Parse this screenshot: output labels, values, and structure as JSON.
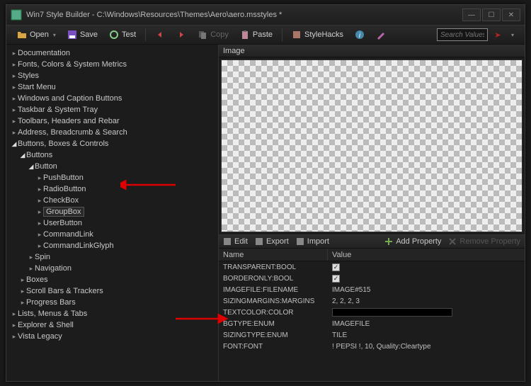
{
  "window": {
    "title": "Win7 Style Builder - C:\\Windows\\Resources\\Themes\\Aero\\aero.msstyles *"
  },
  "toolbar": {
    "open": "Open",
    "save": "Save",
    "test": "Test",
    "copy": "Copy",
    "paste": "Paste",
    "stylehacks": "StyleHacks",
    "search_placeholder": "Search Values"
  },
  "tree": {
    "items": [
      {
        "label": "Documentation",
        "indent": 0,
        "open": false
      },
      {
        "label": "Fonts, Colors & System Metrics",
        "indent": 0,
        "open": false
      },
      {
        "label": "Styles",
        "indent": 0,
        "open": false
      },
      {
        "label": "Start Menu",
        "indent": 0,
        "open": false
      },
      {
        "label": "Windows and Caption Buttons",
        "indent": 0,
        "open": false
      },
      {
        "label": "Taskbar & System Tray",
        "indent": 0,
        "open": false
      },
      {
        "label": "Toolbars, Headers and Rebar",
        "indent": 0,
        "open": false
      },
      {
        "label": "Address, Breadcrumb & Search",
        "indent": 0,
        "open": false
      },
      {
        "label": "Buttons, Boxes & Controls",
        "indent": 0,
        "open": true
      },
      {
        "label": "Buttons",
        "indent": 1,
        "open": true
      },
      {
        "label": "Button",
        "indent": 2,
        "open": true
      },
      {
        "label": "PushButton",
        "indent": 3,
        "open": false
      },
      {
        "label": "RadioButton",
        "indent": 3,
        "open": false
      },
      {
        "label": "CheckBox",
        "indent": 3,
        "open": false
      },
      {
        "label": "GroupBox",
        "indent": 3,
        "open": false,
        "selected": true
      },
      {
        "label": "UserButton",
        "indent": 3,
        "open": false
      },
      {
        "label": "CommandLink",
        "indent": 3,
        "open": false
      },
      {
        "label": "CommandLinkGlyph",
        "indent": 3,
        "open": false
      },
      {
        "label": "Spin",
        "indent": 2,
        "open": false
      },
      {
        "label": "Navigation",
        "indent": 2,
        "open": false
      },
      {
        "label": "Boxes",
        "indent": 1,
        "open": false
      },
      {
        "label": "Scroll Bars & Trackers",
        "indent": 1,
        "open": false
      },
      {
        "label": "Progress Bars",
        "indent": 1,
        "open": false
      },
      {
        "label": "Lists, Menus & Tabs",
        "indent": 0,
        "open": false
      },
      {
        "label": "Explorer & Shell",
        "indent": 0,
        "open": false
      },
      {
        "label": "Vista Legacy",
        "indent": 0,
        "open": false
      }
    ]
  },
  "image_panel": {
    "title": "Image"
  },
  "prop_toolbar": {
    "edit": "Edit",
    "export": "Export",
    "import": "Import",
    "add": "Add Property",
    "remove": "Remove Property"
  },
  "prop_header": {
    "name": "Name",
    "value": "Value"
  },
  "props": [
    {
      "name": "TRANSPARENT:BOOL",
      "type": "check",
      "value": true
    },
    {
      "name": "BORDERONLY:BOOL",
      "type": "check",
      "value": true
    },
    {
      "name": "IMAGEFILE:FILENAME",
      "type": "text",
      "value": "IMAGE#515"
    },
    {
      "name": "SIZINGMARGINS:MARGINS",
      "type": "text",
      "value": "2, 2, 2, 3"
    },
    {
      "name": "TEXTCOLOR:COLOR",
      "type": "color",
      "value": "#000000"
    },
    {
      "name": "BGTYPE:ENUM",
      "type": "text",
      "value": "IMAGEFILE"
    },
    {
      "name": "SIZINGTYPE:ENUM",
      "type": "text",
      "value": "TILE"
    },
    {
      "name": "FONT:FONT",
      "type": "text",
      "value": "! PEPSI !, 10, Quality:Cleartype"
    }
  ]
}
